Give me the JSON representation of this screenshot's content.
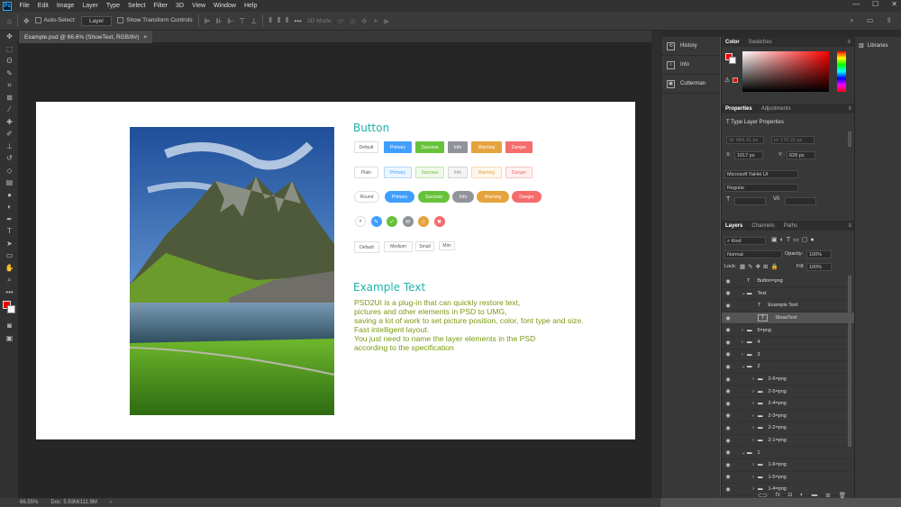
{
  "app": {
    "logo": "Ps"
  },
  "menu": [
    "File",
    "Edit",
    "Image",
    "Layer",
    "Type",
    "Select",
    "Filter",
    "3D",
    "View",
    "Window",
    "Help"
  ],
  "options": {
    "auto_select_label": "Auto-Select:",
    "layer_value": "Layer",
    "transform_label": "Show Transform Controls",
    "mode_label": "3D Mode:"
  },
  "document": {
    "tab_title": "Example.psd @ 66.6% (ShowText, RGB/8#)",
    "close": "×"
  },
  "status": {
    "zoom": "66.55%",
    "doc": "Doc: 5.93M/111.9M"
  },
  "artboard": {
    "button_title": "Button",
    "row1": [
      "Default",
      "Primary",
      "Success",
      "Info",
      "Warning",
      "Danger"
    ],
    "row2": [
      "Plain",
      "Primary",
      "Success",
      "Info",
      "Warning",
      "Danger"
    ],
    "row3": [
      "Round",
      "Primary",
      "Success",
      "Info",
      "Warning",
      "Danger"
    ],
    "sizes": [
      "Default",
      "Medium",
      "Small",
      "Mini"
    ],
    "example_title": "Example Text",
    "example_lines": [
      "PSD2UI is a plug-in that can quickly restore text,",
      "pictures and other elements in PSD to UMG,",
      "saving a lot of work to set picture position, color, font type and size.",
      "Fast intelligent layout.",
      "You just need to name the layer elements in the PSD",
      "according to the specification"
    ]
  },
  "collapsed": [
    "History",
    "Info",
    "Cutterman"
  ],
  "color_panel": {
    "tabs": [
      "Color",
      "Swatches"
    ]
  },
  "properties": {
    "tabs": [
      "Properties",
      "Adjustments"
    ],
    "type_label": "Type Layer Properties",
    "w": "W: 664.31 px",
    "h": "H: 170.31 px",
    "x": "1017 px",
    "y": "628 px",
    "font": "Microsoft YaHei UI",
    "style": "Regular"
  },
  "layers_panel": {
    "tabs": [
      "Layers",
      "Channels",
      "Paths"
    ],
    "kind": "Kind",
    "blend": "Normal",
    "opacity_label": "Opacity:",
    "opacity": "100%",
    "lock_label": "Lock:",
    "fill_label": "Fill:",
    "fill": "100%",
    "layers": [
      "Button=png",
      "Text",
      "Example Text",
      "ShowText",
      "5=png",
      "4",
      "3",
      "2",
      "2-6=png",
      "2-5=png",
      "2-4=png",
      "2-3=png",
      "2-2=png",
      "2-1=png",
      "1",
      "1-6=png",
      "1-5=png",
      "1-4=png"
    ]
  },
  "libraries": {
    "label": "Libraries"
  },
  "colors": {
    "primary": "#409eff",
    "success": "#67c23a",
    "info": "#909399",
    "warning": "#e6a23c",
    "danger": "#f56c6c",
    "teal": "#20b2aa"
  }
}
